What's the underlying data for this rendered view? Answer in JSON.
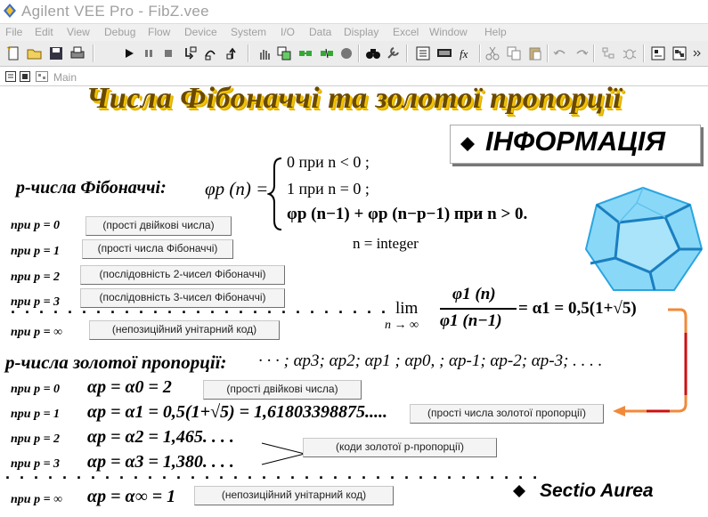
{
  "window": {
    "title": "Agilent VEE Pro - FibZ.vee"
  },
  "menu": [
    "File",
    "Edit",
    "View",
    "Debug",
    "Flow",
    "Device",
    "System",
    "I/O",
    "Data",
    "Display",
    "Excel",
    "Window",
    "Help"
  ],
  "panel": {
    "label": "Main"
  },
  "heading": "Числа Фібоначчі та золотої пропорції",
  "info_button": "ІНФОРМАЦІЯ",
  "fib": {
    "label": "p-числа Фібоначчі:",
    "phi_p_n": "φp (n) =",
    "case1": "0  при n < 0 ;",
    "case2": "1  при n = 0 ;",
    "case3": "φp (n−1) + φp (n−p−1) при n > 0.",
    "n_integer": "n = integer"
  },
  "rows_top": [
    {
      "p_label": "при  p = 0",
      "button": "(прості двійкові числа)"
    },
    {
      "p_label": "при  p = 1",
      "button": "(прості числа Фібоначчі)"
    },
    {
      "p_label": "при  p = 2",
      "button": "(послідовність 2-чисел Фібоначчі)"
    },
    {
      "p_label": "при  p = 3",
      "button": "(послідовність 3-чисел Фібоначчі)"
    },
    {
      "p_label": "при  p = ∞",
      "button": "(непозиційний унітарний код)"
    }
  ],
  "limit": {
    "lim": "lim",
    "sub": "n → ∞",
    "num": "φ1 (n)",
    "den": "φ1 (n−1)",
    "rhs": "= α1 = 0,5(1+√5)"
  },
  "golden": {
    "label": "p-числа золотої пропорції:",
    "sequence": "· · · ; αp3; αp2; αp1 ; αp0, ; αp-1; αp-2; αp-3; . . . ."
  },
  "rows_bottom": [
    {
      "p_label": "при  p = 0",
      "formula": "αp = α0 = 2",
      "button": "(прості двійкові числа)"
    },
    {
      "p_label": "при  p = 1",
      "formula": "αp = α1 = 0,5(1+√5) = 1,61803398875.....",
      "button": "(прості числа золотої пропорції)"
    },
    {
      "p_label": "при  p = 2",
      "formula": "αp = α2 = 1,465. . . ."
    },
    {
      "p_label": "при  p = 3",
      "formula": "αp = α3 = 1,380. . . ."
    },
    {
      "p_label": "при  p = ∞",
      "formula": "αp = α∞ = 1",
      "button": "(непозиційний унітарний код)"
    }
  ],
  "codes_button": "(коди золотої р-пропорції)",
  "sectio": "Sectio Aurea",
  "colors": {
    "heading": "#6b4a00",
    "heading_shadow": "#f2c400",
    "arrow": "#f08a3a",
    "arrow_red": "#cc1010",
    "dodeca": "#7fd3f5"
  }
}
